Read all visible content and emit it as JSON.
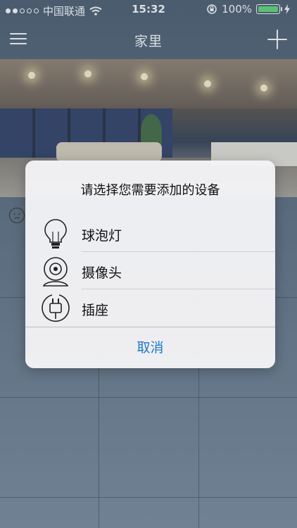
{
  "status_bar": {
    "carrier": "中国联通",
    "time": "15:32",
    "battery": "100%"
  },
  "nav": {
    "title": "家里"
  },
  "dialog": {
    "title": "请选择您需要添加的设备",
    "options": [
      {
        "label": "球泡灯",
        "icon": "bulb-icon"
      },
      {
        "label": "摄像头",
        "icon": "camera-icon"
      },
      {
        "label": "插座",
        "icon": "plug-icon"
      }
    ],
    "cancel_label": "取消"
  },
  "colors": {
    "accent": "#1a7ad9",
    "battery": "#4cd964"
  }
}
